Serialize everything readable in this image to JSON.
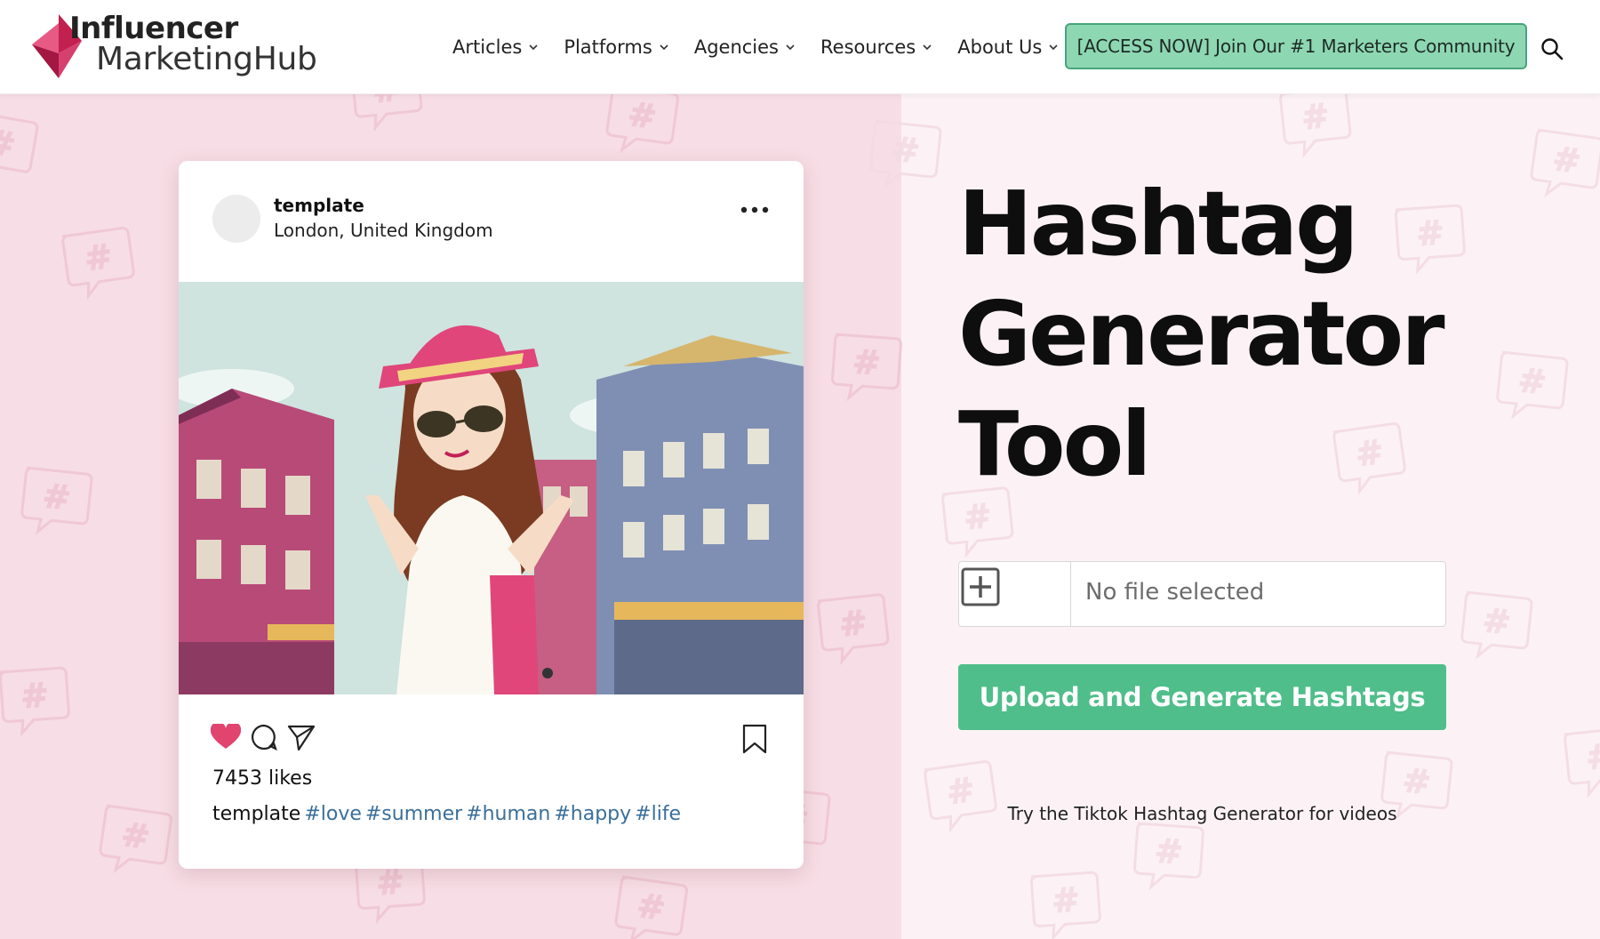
{
  "header": {
    "logo": {
      "line1": "Influencer",
      "line2": "MarketingHub"
    },
    "nav": [
      {
        "label": "Articles"
      },
      {
        "label": "Platforms"
      },
      {
        "label": "Agencies"
      },
      {
        "label": "Resources"
      },
      {
        "label": "About Us"
      }
    ],
    "cta_label": "[ACCESS NOW] Join Our #1 Marketers Community",
    "search_icon": "search-icon"
  },
  "post": {
    "username": "template",
    "location": "London, United Kingdom",
    "likes": "7453 likes",
    "caption_user": "template",
    "hashtags": [
      "#love",
      "#summer",
      "#human",
      "#happy",
      "#life"
    ],
    "icons": [
      "more-icon",
      "heart-icon",
      "comment-icon",
      "share-icon",
      "bookmark-icon"
    ]
  },
  "tool": {
    "title_lines": [
      "Hashtag",
      "Generator",
      "Tool"
    ],
    "file_placeholder": "No file selected",
    "upload_label": "Upload and Generate Hashtags",
    "tiktok_link": "Try the Tiktok Hashtag Generator for videos"
  },
  "colors": {
    "brand": "#d6406e",
    "cta_bg": "#8ed7b3",
    "upload_bg": "#4fbe8a",
    "hero_left_bg": "#f7dde5",
    "hero_right_bg": "#fcf2f5",
    "hashtag_link": "#3a6f9a"
  }
}
